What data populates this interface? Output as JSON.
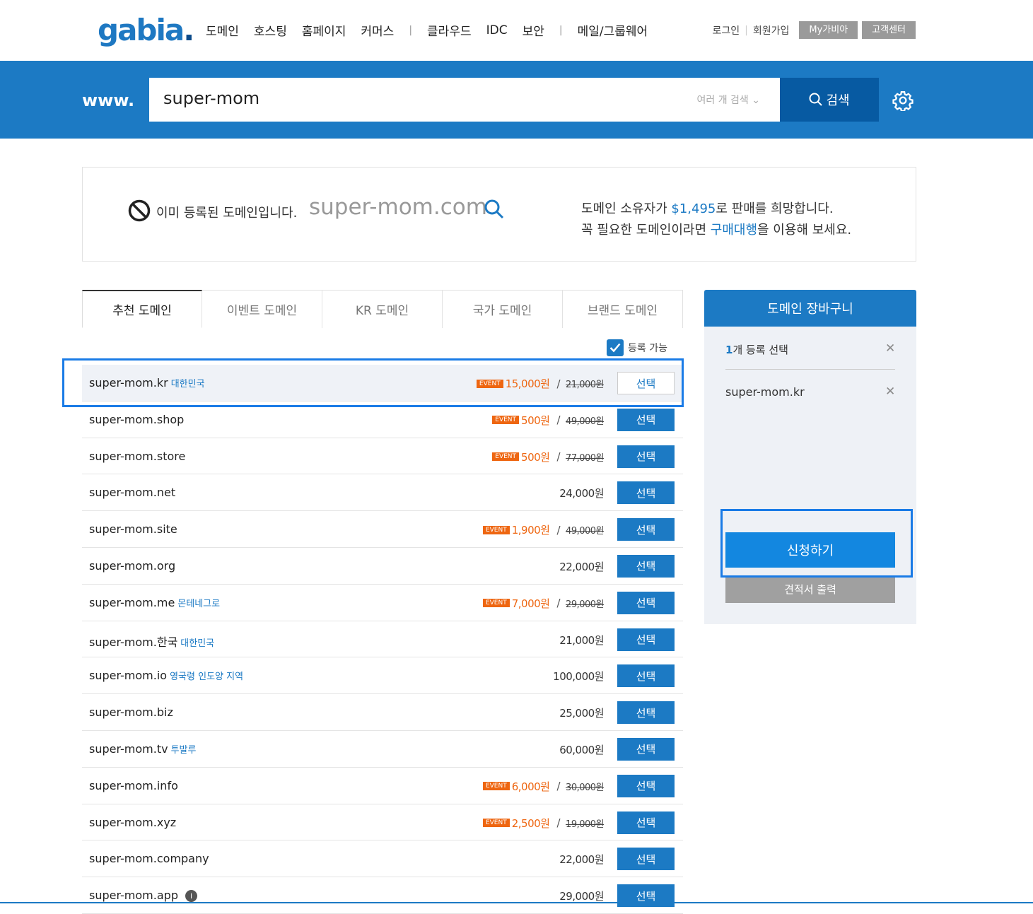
{
  "header": {
    "logo": "gabia",
    "logo_dot": ".",
    "nav": [
      "도메인",
      "호스팅",
      "홈페이지",
      "커머스",
      "클라우드",
      "IDC",
      "보안",
      "메일/그룹웨어"
    ],
    "login": "로그인",
    "signup": "회원가입",
    "mygabia": "My가비아",
    "support": "고객센터"
  },
  "search": {
    "prefix": "www.",
    "query": "super-mom",
    "multi_label": "여러 개 검색",
    "button_label": "검색"
  },
  "notice": {
    "taken_text": "이미 등록된 도메인입니다.",
    "domain": "super-mom.com",
    "sale_prefix": "도메인 소유자가 ",
    "sale_price": "$1,495",
    "sale_suffix": "로 판매를 희망합니다.",
    "line2_prefix": "꼭 필요한 도메인이라면 ",
    "line2_link": "구매대행",
    "line2_suffix": "을 이용해 보세요."
  },
  "tabs": [
    "추천 도메인",
    "이벤트 도메인",
    "KR 도메인",
    "국가 도메인",
    "브랜드 도메인"
  ],
  "filter": {
    "available_label": "등록 가능"
  },
  "event_badge": "EVENT",
  "select_label": "선택",
  "domains": [
    {
      "name": "super-mom.kr",
      "country": "대한민국",
      "event": true,
      "price": "15,000원",
      "original": "21,000원",
      "selected": true
    },
    {
      "name": "super-mom.shop",
      "country": "",
      "event": true,
      "price": "500원",
      "original": "49,000원"
    },
    {
      "name": "super-mom.store",
      "country": "",
      "event": true,
      "price": "500원",
      "original": "77,000원"
    },
    {
      "name": "super-mom.net",
      "country": "",
      "event": false,
      "price": "24,000원"
    },
    {
      "name": "super-mom.site",
      "country": "",
      "event": true,
      "price": "1,900원",
      "original": "49,000원"
    },
    {
      "name": "super-mom.org",
      "country": "",
      "event": false,
      "price": "22,000원"
    },
    {
      "name": "super-mom.me",
      "country": "몬테네그로",
      "event": true,
      "price": "7,000원",
      "original": "29,000원"
    },
    {
      "name": "super-mom.한국",
      "country": "대한민국",
      "event": false,
      "price": "21,000원"
    },
    {
      "name": "super-mom.io",
      "country": "영국령 인도양 지역",
      "event": false,
      "price": "100,000원"
    },
    {
      "name": "super-mom.biz",
      "country": "",
      "event": false,
      "price": "25,000원"
    },
    {
      "name": "super-mom.tv",
      "country": "투발루",
      "event": false,
      "price": "60,000원"
    },
    {
      "name": "super-mom.info",
      "country": "",
      "event": true,
      "price": "6,000원",
      "original": "30,000원"
    },
    {
      "name": "super-mom.xyz",
      "country": "",
      "event": true,
      "price": "2,500원",
      "original": "19,000원"
    },
    {
      "name": "super-mom.company",
      "country": "",
      "event": false,
      "price": "22,000원"
    },
    {
      "name": "super-mom.app",
      "country": "",
      "info": true,
      "event": false,
      "price": "29,000원"
    }
  ],
  "cart": {
    "title": "도메인 장바구니",
    "count": "1",
    "count_suffix": "개 등록 선택",
    "item": "super-mom.kr",
    "apply_label": "신청하기",
    "quote_label": "견적서 출력"
  },
  "colors": {
    "brand": "#1c7ac4",
    "event": "#ee6611",
    "highlight": "#1a7be6"
  }
}
